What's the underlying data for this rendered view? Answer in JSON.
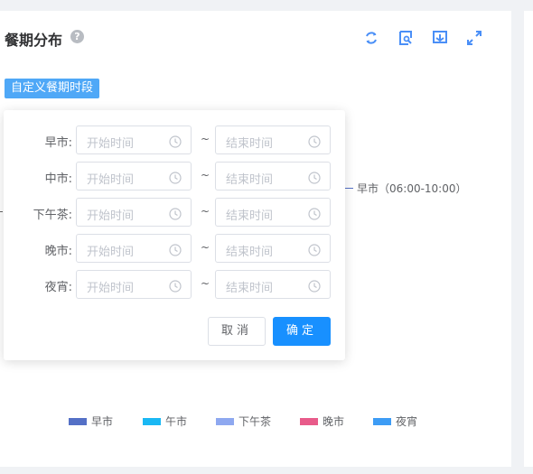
{
  "panel": {
    "title": "餐期分布",
    "help_icon": "?",
    "custom_period_button": "自定义餐期时段"
  },
  "toolbar": {
    "icons": [
      "refresh-icon",
      "data-view-icon",
      "save-image-icon",
      "fullscreen-icon"
    ],
    "accent": "#4a8ff7"
  },
  "chart_data": {
    "type": "pie",
    "legend_position": "bottom",
    "visible_label": "早市（06:00-10:00）",
    "series": [
      {
        "name": "早市",
        "color": "#5470c6"
      },
      {
        "name": "午市",
        "color": "#1ab8f4"
      },
      {
        "name": "下午茶",
        "color": "#8ea8f0"
      },
      {
        "name": "晚市",
        "color": "#e85b8a"
      },
      {
        "name": "夜宵",
        "color": "#3d9cf5"
      }
    ]
  },
  "popover": {
    "rows": [
      {
        "label": "早市:",
        "start_placeholder": "开始时间",
        "end_placeholder": "结束时间"
      },
      {
        "label": "中市:",
        "start_placeholder": "开始时间",
        "end_placeholder": "结束时间"
      },
      {
        "label": "下午茶:",
        "start_placeholder": "开始时间",
        "end_placeholder": "结束时间"
      },
      {
        "label": "晚市:",
        "start_placeholder": "开始时间",
        "end_placeholder": "结束时间"
      },
      {
        "label": "夜宵:",
        "start_placeholder": "开始时间",
        "end_placeholder": "结束时间"
      }
    ],
    "separator": "~",
    "cancel_label": "取消",
    "confirm_label": "确定"
  }
}
